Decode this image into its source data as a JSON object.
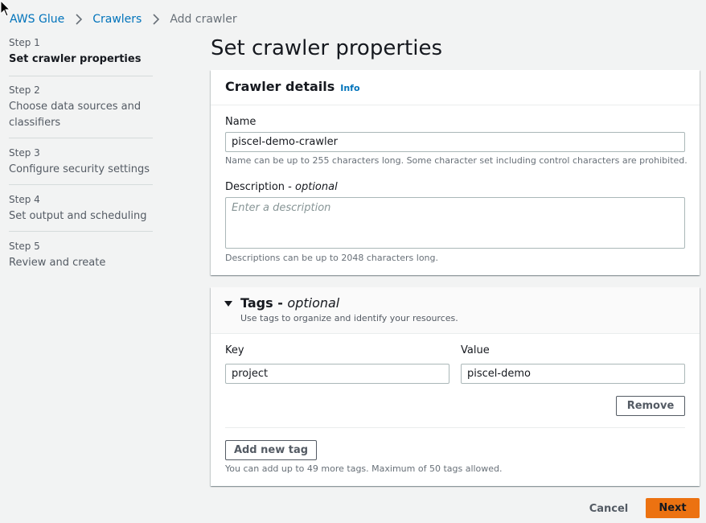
{
  "breadcrumb": {
    "items": [
      "AWS Glue",
      "Crawlers"
    ],
    "current": "Add crawler"
  },
  "steps": [
    {
      "label": "Step 1",
      "title": "Set crawler properties"
    },
    {
      "label": "Step 2",
      "title": "Choose data sources and classifiers"
    },
    {
      "label": "Step 3",
      "title": "Configure security settings"
    },
    {
      "label": "Step 4",
      "title": "Set output and scheduling"
    },
    {
      "label": "Step 5",
      "title": "Review and create"
    }
  ],
  "page_title": "Set crawler properties",
  "crawler_details": {
    "title": "Crawler details",
    "info_link": "Info",
    "name_label": "Name",
    "name_value": "piscel-demo-crawler",
    "name_hint": "Name can be up to 255 characters long. Some character set including control characters are prohibited.",
    "description_label": "Description",
    "description_optional": "optional",
    "description_placeholder": "Enter a description",
    "description_hint": "Descriptions can be up to 2048 characters long."
  },
  "tags": {
    "title": "Tags",
    "optional": "optional",
    "subtitle": "Use tags to organize and identify your resources.",
    "key_label": "Key",
    "value_label": "Value",
    "key_value": "project",
    "value_value": "piscel-demo",
    "remove_label": "Remove",
    "add_label": "Add new tag",
    "limit_hint": "You can add up to 49 more tags. Maximum of 50 tags allowed."
  },
  "footer": {
    "cancel_label": "Cancel",
    "next_label": "Next"
  },
  "colors": {
    "link": "#0073bb",
    "primary": "#ec7211",
    "background": "#f2f3f3"
  }
}
